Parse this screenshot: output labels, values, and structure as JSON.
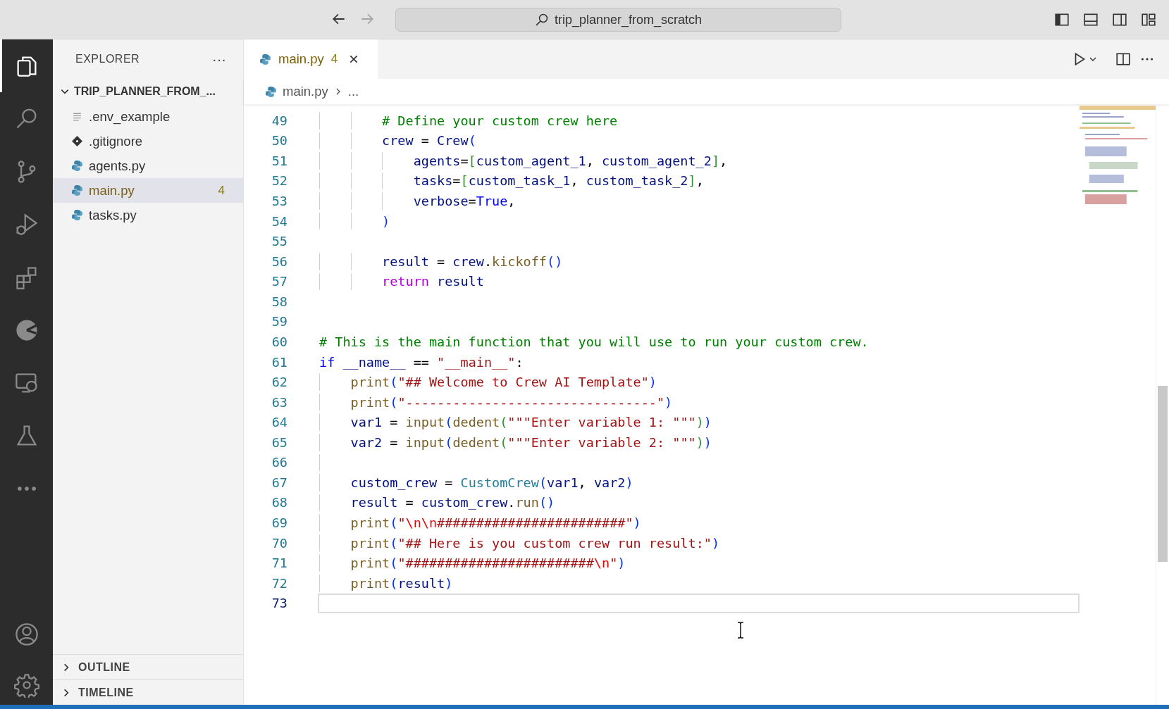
{
  "title_bar": {
    "back_enabled": true,
    "forward_enabled": false,
    "search": {
      "value": "trip_planner_from_scratch"
    }
  },
  "activity_bar": {
    "items": [
      {
        "selected": true
      },
      {
        "selected": false
      },
      {
        "selected": false
      },
      {
        "selected": false
      },
      {
        "selected": false
      },
      {
        "selected": false
      },
      {
        "selected": false
      },
      {
        "selected": false
      },
      {
        "selected": false
      }
    ]
  },
  "sidebar": {
    "title": "EXPLORER",
    "more": "···",
    "folder": {
      "name": "TRIP_PLANNER_FROM_...",
      "expanded": true,
      "files": [
        {
          "name": ".env_example",
          "kind": "text",
          "selected": false,
          "warning": false
        },
        {
          "name": ".gitignore",
          "kind": "git",
          "selected": false,
          "warning": false
        },
        {
          "name": "agents.py",
          "kind": "python",
          "selected": false,
          "warning": false
        },
        {
          "name": "main.py",
          "kind": "python",
          "selected": true,
          "warning": true,
          "badge": "4"
        },
        {
          "name": "tasks.py",
          "kind": "python",
          "selected": false,
          "warning": false
        }
      ]
    },
    "sections": [
      {
        "title": "OUTLINE",
        "expanded": false
      },
      {
        "title": "TIMELINE",
        "expanded": false
      }
    ]
  },
  "tabs": [
    {
      "label": "main.py",
      "badge": "4",
      "selected": true,
      "warning": true
    }
  ],
  "breadcrumb": {
    "file": "main.py",
    "rest": "..."
  },
  "code": {
    "lines": [
      {
        "number": "49",
        "current": false,
        "kind": "nested",
        "tokens": [
          {
            "kind": "cm",
            "t": "# Define your custom crew here"
          }
        ]
      },
      {
        "number": "50",
        "current": false,
        "kind": "nested",
        "tokens": [
          {
            "kind": "var",
            "t": "crew"
          },
          {
            "kind": "op",
            "t": " = "
          },
          {
            "kind": "var",
            "t": "Crew"
          },
          {
            "kind": "b1",
            "t": "("
          }
        ]
      },
      {
        "number": "51",
        "current": false,
        "kind": "deep",
        "tokens": [
          {
            "kind": "var",
            "t": "agents"
          },
          {
            "kind": "op",
            "t": "="
          },
          {
            "kind": "b2",
            "t": "["
          },
          {
            "kind": "var",
            "t": "custom_agent_1"
          },
          {
            "kind": "op",
            "t": ", "
          },
          {
            "kind": "var",
            "t": "custom_agent_2"
          },
          {
            "kind": "b2",
            "t": "]"
          },
          {
            "kind": "op",
            "t": ","
          }
        ]
      },
      {
        "number": "52",
        "current": false,
        "kind": "deep",
        "tokens": [
          {
            "kind": "var",
            "t": "tasks"
          },
          {
            "kind": "op",
            "t": "="
          },
          {
            "kind": "b2",
            "t": "["
          },
          {
            "kind": "var",
            "t": "custom_task_1"
          },
          {
            "kind": "op",
            "t": ", "
          },
          {
            "kind": "var",
            "t": "custom_task_2"
          },
          {
            "kind": "b2",
            "t": "]"
          },
          {
            "kind": "op",
            "t": ","
          }
        ]
      },
      {
        "number": "53",
        "current": false,
        "kind": "deep",
        "tokens": [
          {
            "kind": "var",
            "t": "verbose"
          },
          {
            "kind": "op",
            "t": "="
          },
          {
            "kind": "kw",
            "t": "True"
          },
          {
            "kind": "op",
            "t": ","
          }
        ]
      },
      {
        "number": "54",
        "current": false,
        "kind": "nested",
        "tokens": [
          {
            "kind": "b1",
            "t": ")"
          }
        ]
      },
      {
        "number": "55",
        "current": false,
        "kind": "top"
      },
      {
        "number": "56",
        "current": false,
        "kind": "nested",
        "tokens": [
          {
            "kind": "var",
            "t": "result"
          },
          {
            "kind": "op",
            "t": " = "
          },
          {
            "kind": "var",
            "t": "crew"
          },
          {
            "kind": "op",
            "t": "."
          },
          {
            "kind": "fn",
            "t": "kickoff"
          },
          {
            "kind": "b1",
            "t": "()"
          }
        ]
      },
      {
        "number": "57",
        "current": false,
        "kind": "nested",
        "tokens": [
          {
            "kind": "ctl",
            "t": "return"
          },
          {
            "kind": "var",
            "t": " result"
          }
        ]
      },
      {
        "number": "58",
        "current": false,
        "kind": "top"
      },
      {
        "number": "59",
        "current": false,
        "kind": "top"
      },
      {
        "number": "60",
        "current": false,
        "kind": "top",
        "tokens": [
          {
            "kind": "cm",
            "t": "# This is the main function that you will use to run your custom crew."
          }
        ]
      },
      {
        "number": "61",
        "current": false,
        "kind": "top",
        "tokens": [
          {
            "kind": "kw",
            "t": "if"
          },
          {
            "kind": "var",
            "t": " __name__"
          },
          {
            "kind": "op",
            "t": " == "
          },
          {
            "kind": "str",
            "t": "\"__main__\""
          },
          {
            "kind": "op",
            "t": ":"
          }
        ]
      },
      {
        "number": "62",
        "current": false,
        "kind": "body",
        "tokens": [
          {
            "kind": "fn",
            "t": "print"
          },
          {
            "kind": "b1",
            "t": "("
          },
          {
            "kind": "str",
            "t": "\"## Welcome to Crew AI Template\""
          },
          {
            "kind": "b1",
            "t": ")"
          }
        ]
      },
      {
        "number": "63",
        "current": false,
        "kind": "body",
        "tokens": [
          {
            "kind": "fn",
            "t": "print"
          },
          {
            "kind": "b1",
            "t": "("
          },
          {
            "kind": "str",
            "t": "\"--------------------------------\""
          },
          {
            "kind": "b1",
            "t": ")"
          }
        ]
      },
      {
        "number": "64",
        "current": false,
        "kind": "body",
        "tokens": [
          {
            "kind": "var",
            "t": "var1"
          },
          {
            "kind": "op",
            "t": " = "
          },
          {
            "kind": "fn",
            "t": "input"
          },
          {
            "kind": "b1",
            "t": "("
          },
          {
            "kind": "fn",
            "t": "dedent"
          },
          {
            "kind": "b2",
            "t": "("
          },
          {
            "kind": "str",
            "t": "\"\"\"Enter variable 1: \"\"\""
          },
          {
            "kind": "b2",
            "t": ")"
          },
          {
            "kind": "b1",
            "t": ")"
          }
        ]
      },
      {
        "number": "65",
        "current": false,
        "kind": "body",
        "tokens": [
          {
            "kind": "var",
            "t": "var2"
          },
          {
            "kind": "op",
            "t": " = "
          },
          {
            "kind": "fn",
            "t": "input"
          },
          {
            "kind": "b1",
            "t": "("
          },
          {
            "kind": "fn",
            "t": "dedent"
          },
          {
            "kind": "b2",
            "t": "("
          },
          {
            "kind": "str",
            "t": "\"\"\"Enter variable 2: \"\"\""
          },
          {
            "kind": "b2",
            "t": ")"
          },
          {
            "kind": "b1",
            "t": ")"
          }
        ]
      },
      {
        "number": "66",
        "current": false,
        "kind": "body"
      },
      {
        "number": "67",
        "current": false,
        "kind": "body",
        "tokens": [
          {
            "kind": "var",
            "t": "custom_crew"
          },
          {
            "kind": "op",
            "t": " = "
          },
          {
            "kind": "cls",
            "t": "CustomCrew"
          },
          {
            "kind": "b1",
            "t": "("
          },
          {
            "kind": "var",
            "t": "var1"
          },
          {
            "kind": "op",
            "t": ", "
          },
          {
            "kind": "var",
            "t": "var2"
          },
          {
            "kind": "b1",
            "t": ")"
          }
        ]
      },
      {
        "number": "68",
        "current": false,
        "kind": "body",
        "tokens": [
          {
            "kind": "var",
            "t": "result"
          },
          {
            "kind": "op",
            "t": " = "
          },
          {
            "kind": "var",
            "t": "custom_crew"
          },
          {
            "kind": "op",
            "t": "."
          },
          {
            "kind": "fn",
            "t": "run"
          },
          {
            "kind": "b1",
            "t": "()"
          }
        ]
      },
      {
        "number": "69",
        "current": false,
        "kind": "body",
        "tokens": [
          {
            "kind": "fn",
            "t": "print"
          },
          {
            "kind": "b1",
            "t": "("
          },
          {
            "kind": "str",
            "t": "\""
          },
          {
            "kind": "esc",
            "t": "\\n\\n"
          },
          {
            "kind": "str",
            "t": "########################\""
          },
          {
            "kind": "b1",
            "t": ")"
          }
        ]
      },
      {
        "number": "70",
        "current": false,
        "kind": "body",
        "tokens": [
          {
            "kind": "fn",
            "t": "print"
          },
          {
            "kind": "b1",
            "t": "("
          },
          {
            "kind": "str",
            "t": "\"## Here is you custom crew run result:\""
          },
          {
            "kind": "b1",
            "t": ")"
          }
        ]
      },
      {
        "number": "71",
        "current": false,
        "kind": "body",
        "tokens": [
          {
            "kind": "fn",
            "t": "print"
          },
          {
            "kind": "b1",
            "t": "("
          },
          {
            "kind": "str",
            "t": "\"########################"
          },
          {
            "kind": "esc",
            "t": "\\n"
          },
          {
            "kind": "str",
            "t": "\""
          },
          {
            "kind": "b1",
            "t": ")"
          }
        ]
      },
      {
        "number": "72",
        "current": false,
        "kind": "body",
        "tokens": [
          {
            "kind": "fn",
            "t": "print"
          },
          {
            "kind": "b1",
            "t": "("
          },
          {
            "kind": "var",
            "t": "result"
          },
          {
            "kind": "b1",
            "t": ")"
          }
        ]
      },
      {
        "number": "73",
        "current": true,
        "kind": "top"
      }
    ]
  }
}
